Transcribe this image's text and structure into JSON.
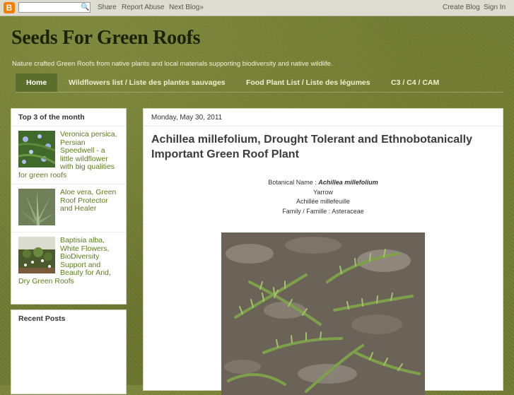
{
  "navbar": {
    "logo_letter": "B",
    "search_icon": "search-icon",
    "links": [
      "Share",
      "Report Abuse",
      "Next Blog»"
    ],
    "right_links": [
      "Create Blog",
      "Sign In"
    ]
  },
  "header": {
    "title": "Seeds For Green Roofs",
    "description": "Nature crafted Green Roofs from native plants and local materials supporting biodiversity and native wildlife."
  },
  "tabs": [
    {
      "label": "Home",
      "active": true
    },
    {
      "label": "Wildflowers list / Liste des plantes sauvages",
      "active": false
    },
    {
      "label": "Food Plant List / Liste des légumes",
      "active": false
    },
    {
      "label": "C3 / C4 / CAM",
      "active": false
    }
  ],
  "sidebar": {
    "popular": {
      "title": "Top 3 of the month",
      "items": [
        {
          "text": "Veronica persica, Persian Speedwell - a little wildflower with big qualities for green roofs"
        },
        {
          "text": "Aloe vera, Green Roof Protector and Healer"
        },
        {
          "text": "Baptisia alba, White Flowers, BioDiversity Support and Beauty for Arid, Dry Green Roofs"
        }
      ]
    },
    "recent": {
      "title": "Recent Posts"
    }
  },
  "post": {
    "date": "Monday, May 30, 2011",
    "title": "Achillea millefolium, Drought Tolerant and Ethnobotanically Important Green Roof Plant",
    "botanical_label": "Botanical Name : ",
    "botanical_name": "Achillea millefolium",
    "common_en": "Yarrow",
    "common_fr": "Achillée millefeuille",
    "family": "Family / Famille : Asteraceae"
  },
  "colors": {
    "background": "#6e7a33",
    "link_green": "#5b7d1b",
    "active_tab": "#5d6e2c",
    "blogger_orange": "#f57d00"
  }
}
